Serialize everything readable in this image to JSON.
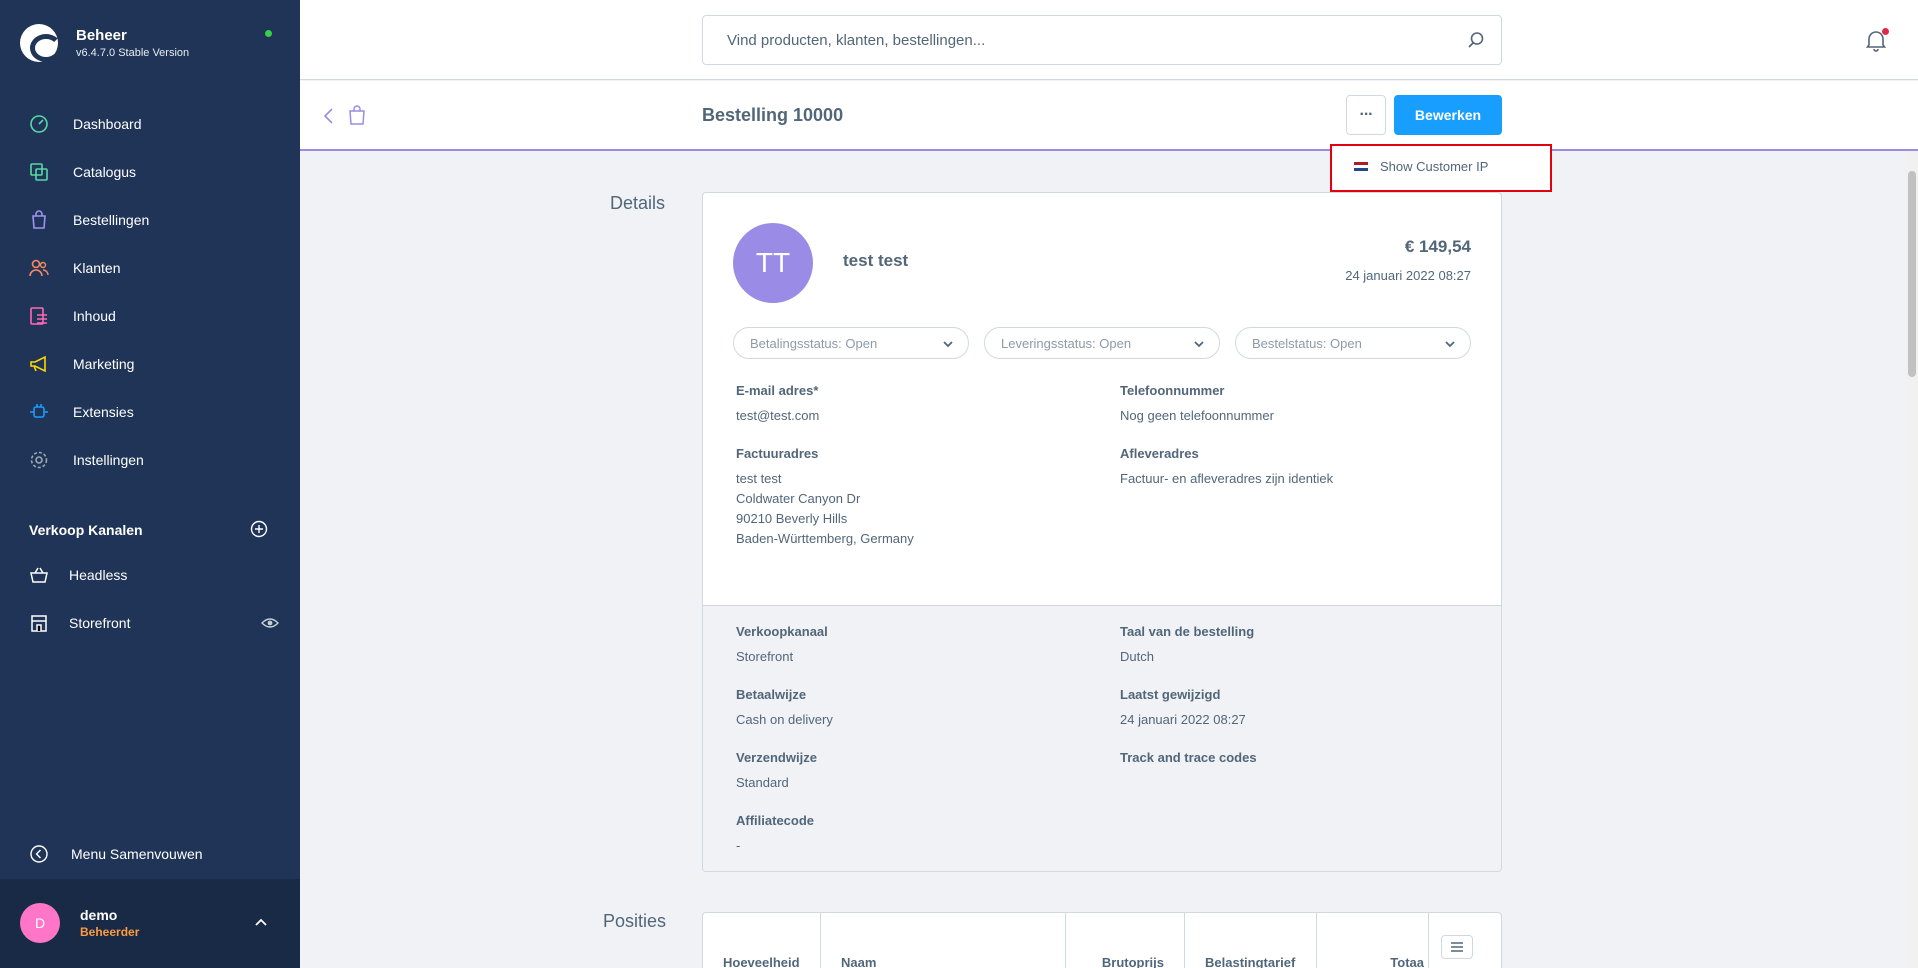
{
  "brand": {
    "name": "Beheer",
    "version": "v6.4.7.0 Stable Version"
  },
  "nav": {
    "items": [
      {
        "label": "Dashboard",
        "icon": "dashboard-icon",
        "color": "#57d9a3"
      },
      {
        "label": "Catalogus",
        "icon": "catalog-icon",
        "color": "#57d9a3"
      },
      {
        "label": "Bestellingen",
        "icon": "bag-icon",
        "color": "#a092f0"
      },
      {
        "label": "Klanten",
        "icon": "customers-icon",
        "color": "#f88962"
      },
      {
        "label": "Inhoud",
        "icon": "content-icon",
        "color": "#ff68b4"
      },
      {
        "label": "Marketing",
        "icon": "megaphone-icon",
        "color": "#ffd700"
      },
      {
        "label": "Extensies",
        "icon": "plug-icon",
        "color": "#189eff"
      },
      {
        "label": "Instellingen",
        "icon": "gear-icon",
        "color": "#9aa8b5"
      }
    ]
  },
  "sales_channels": {
    "title": "Verkoop Kanalen",
    "items": [
      {
        "label": "Headless",
        "icon": "basket-icon"
      },
      {
        "label": "Storefront",
        "icon": "storefront-icon"
      }
    ]
  },
  "collapse_label": "Menu Samenvouwen",
  "user": {
    "initial": "D",
    "name": "demo",
    "role": "Beheerder"
  },
  "search": {
    "placeholder": "Vind producten, klanten, bestellingen..."
  },
  "smartbar": {
    "title": "Bestelling 10000",
    "more_label": "···",
    "edit_label": "Bewerken"
  },
  "context_menu": {
    "item_label": "Show Customer IP"
  },
  "details": {
    "section_label": "Details",
    "avatar_initials": "TT",
    "customer_name": "test test",
    "total": "€ 149,54",
    "date": "24 januari 2022 08:27",
    "statuses": [
      "Betalingsstatus: Open",
      "Leveringsstatus: Open",
      "Bestelstatus: Open"
    ],
    "email_label": "E-mail adres*",
    "email_value": "test@test.com",
    "phone_label": "Telefoonnummer",
    "phone_value": "Nog geen telefoonnummer",
    "billing_label": "Factuuradres",
    "billing_lines": [
      "test test",
      "Coldwater Canyon Dr",
      "90210 Beverly Hills",
      "Baden-Württemberg, Germany"
    ],
    "shipping_label": "Afleveradres",
    "shipping_value": "Factuur- en afleveradres zijn identiek",
    "sales_channel_label": "Verkoopkanaal",
    "sales_channel_value": "Storefront",
    "language_label": "Taal van de bestelling",
    "language_value": "Dutch",
    "payment_label": "Betaalwijze",
    "payment_value": "Cash on delivery",
    "modified_label": "Laatst gewijzigd",
    "modified_value": "24 januari 2022 08:27",
    "shipping_method_label": "Verzendwijze",
    "shipping_method_value": "Standard",
    "tracking_label": "Track and trace codes",
    "affiliate_label": "Affiliatecode",
    "affiliate_value": "-"
  },
  "positions": {
    "section_label": "Posities",
    "columns": [
      "Hoeveelheid",
      "Naam",
      "Brutoprijs",
      "Belastingtarief",
      "Totaa"
    ]
  }
}
